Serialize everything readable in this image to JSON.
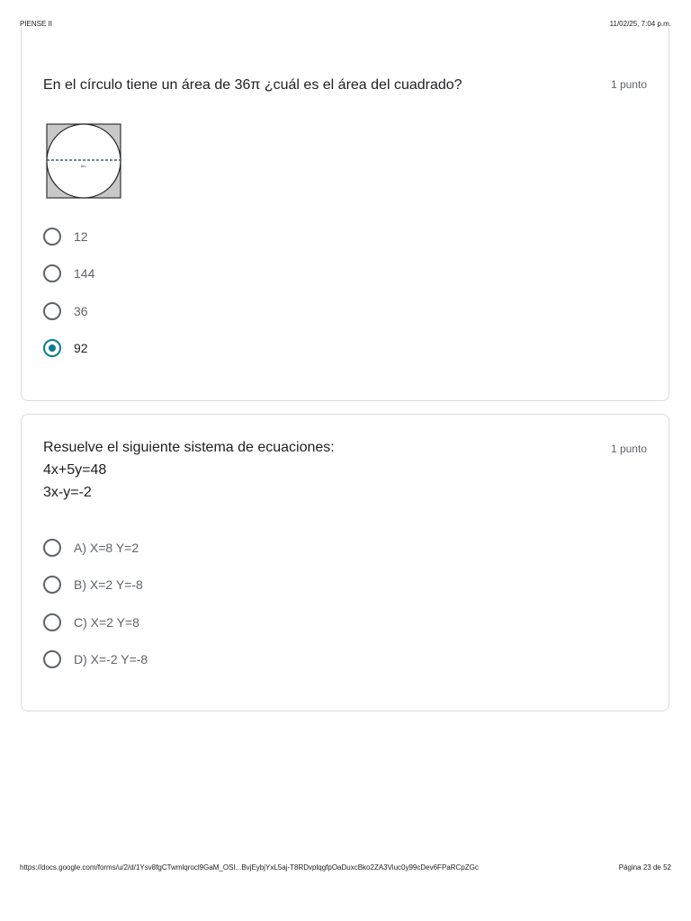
{
  "header": {
    "title": "PIENSE II",
    "datetime": "11/02/25, 7:04 p.m."
  },
  "questions": [
    {
      "title": "En el círculo tiene un área de 36π ¿cuál es el área del cuadrado?",
      "points": "1 punto",
      "figure_label": "6m",
      "options": [
        "12",
        "144",
        "36",
        "92"
      ],
      "selected_index": 3
    },
    {
      "title": "Resuelve el siguiente sistema de ecuaciones:",
      "lines": [
        "4x+5y=48",
        "3x-y=-2"
      ],
      "points": "1 punto",
      "options": [
        "A) X=8 Y=2",
        "B) X=2 Y=-8",
        "C) X=2 Y=8",
        "D) X=-2 Y=-8"
      ],
      "selected_index": null
    }
  ],
  "footer": {
    "url": "https://docs.google.com/forms/u/2/d/1Ysv8fgCTwmlqrocl9GaM_OSI...BvjEybjYxL5aj-T8RDvplqgfpOaDuxcBko2ZA3Viuc0y99cDev6FPaRCpZGc",
    "page": "Página 23 de 52"
  },
  "colors": {
    "accent": "#0b7d8c",
    "border": "#dadce0",
    "muted": "#5f6368"
  }
}
